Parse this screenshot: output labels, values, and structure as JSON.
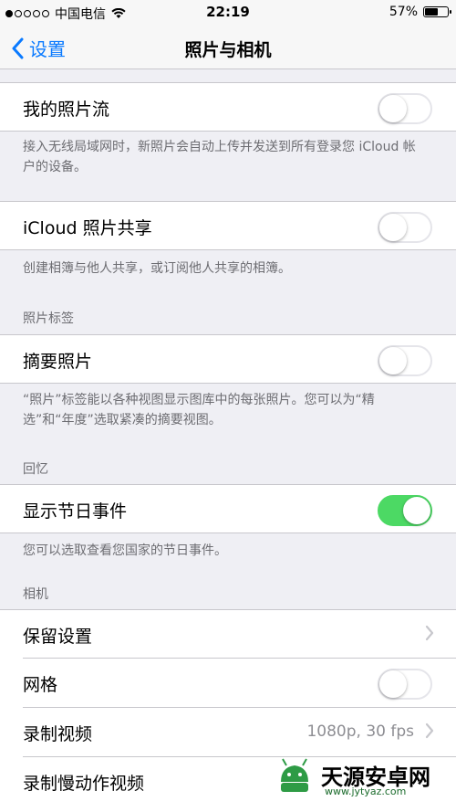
{
  "status_bar": {
    "carrier": "中国电信",
    "time": "22:19",
    "battery_text": "57%",
    "battery_level": 0.57,
    "signal_dots": [
      true,
      false,
      false,
      false,
      false
    ]
  },
  "nav": {
    "back_label": "设置",
    "title": "照片与相机"
  },
  "sections": {
    "photo_stream": {
      "label": "我的照片流",
      "enabled": false,
      "footer": "接入无线局域网时，新照片会自动上传并发送到所有登录您 iCloud 帐户的设备。"
    },
    "icloud_sharing": {
      "label": "iCloud 照片共享",
      "enabled": false,
      "footer": "创建相簿与他人共享，或订阅他人共享的相簿。"
    },
    "photos_tab": {
      "header": "照片标签",
      "summary_label": "摘要照片",
      "summary_enabled": false,
      "footer": "“照片”标签能以各种视图显示图库中的每张照片。您可以为“精选”和“年度”选取紧凑的摘要视图。"
    },
    "memories": {
      "header": "回忆",
      "holiday_label": "显示节日事件",
      "holiday_enabled": true,
      "footer": "您可以选取查看您国家的节日事件。"
    },
    "camera": {
      "header": "相机",
      "preserve_label": "保留设置",
      "grid_label": "网格",
      "grid_enabled": false,
      "record_video_label": "录制视频",
      "record_video_value": "1080p, 30 fps",
      "slomo_label": "录制慢动作视频"
    }
  },
  "watermark": {
    "text": "天源安卓网",
    "url": "www.jytyaz.com"
  },
  "colors": {
    "accent": "#0a7aff",
    "toggle_on": "#4cd964",
    "background": "#efeff4"
  }
}
